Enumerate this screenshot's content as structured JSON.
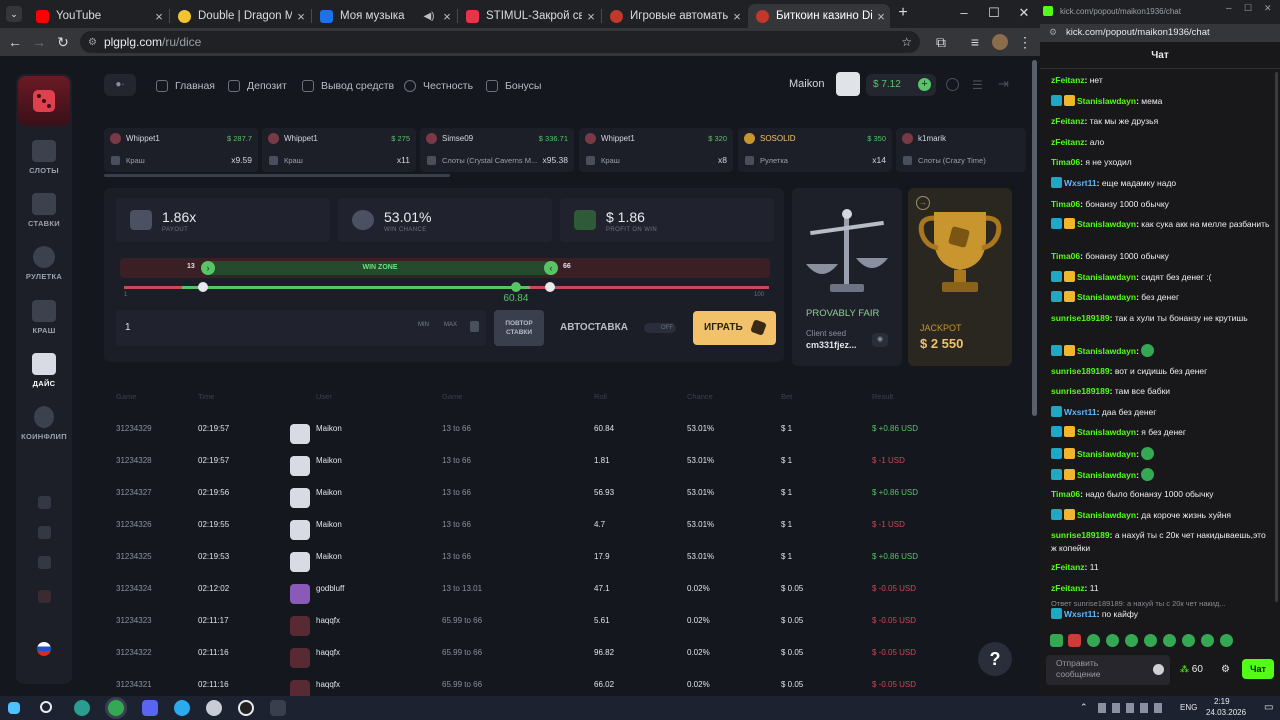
{
  "browser": {
    "tabs": [
      {
        "title": "YouTube",
        "color": "#ff0000"
      },
      {
        "title": "Double | Dragon Money",
        "color": "#f4c430"
      },
      {
        "title": "Моя музыка",
        "color": "#1a73e8"
      },
      {
        "title": "STIMUL-Закрой свой рот",
        "color": "#e8334a"
      },
      {
        "title": "Игровые автоматы на ре",
        "color": "#c0392b"
      },
      {
        "title": "Биткоин казино Dice | Дон",
        "color": "#c0392b"
      }
    ],
    "new_tab": "+",
    "url_domain": "plgplg.com",
    "url_path": "/ru/dice"
  },
  "site": {
    "nav": [
      "Главная",
      "Депозит",
      "Вывод средств",
      "Честность",
      "Бонусы"
    ],
    "username": "Maikon",
    "balance": "$ 7.12",
    "sidebar": [
      {
        "label": "СЛОТЫ",
        "icon": "slots-icon"
      },
      {
        "label": "СТАВКИ",
        "icon": "ticket-icon"
      },
      {
        "label": "РУЛЕТКА",
        "icon": "roulette-icon"
      },
      {
        "label": "КРАШ",
        "icon": "chart-icon"
      },
      {
        "label": "ДАЙС",
        "icon": "dice-icon"
      },
      {
        "label": "КОИНФЛИП",
        "icon": "coinflip-icon"
      }
    ],
    "lang": "RU"
  },
  "feed": [
    {
      "user": "Whippet1",
      "amount": "$ 287.7",
      "game": "Краш",
      "mult": "x9.59"
    },
    {
      "user": "Whippet1",
      "amount": "$ 275",
      "game": "Краш",
      "mult": "x11"
    },
    {
      "user": "Simse09",
      "amount": "$ 336.71",
      "game": "Слоты (Crystal Caverns M...",
      "mult": "x95.38"
    },
    {
      "user": "Whippet1",
      "amount": "$ 320",
      "game": "Краш",
      "mult": "x8"
    },
    {
      "user": "SOSOLID",
      "amount": "$ 350",
      "game": "Рулетка",
      "mult": "x14"
    },
    {
      "user": "k1marik",
      "amount": "",
      "game": "Слоты (Crazy Time)",
      "mult": ""
    }
  ],
  "game": {
    "payout_value": "1.86x",
    "payout_label": "PAYOUT",
    "chance_value": "53.01%",
    "chance_label": "WIN CHANCE",
    "profit_value": "$ 1.86",
    "profit_label": "PROFIT ON WIN",
    "range_low": "13",
    "range_high": "66",
    "win_zone": "WIN ZONE",
    "scale_min": "1",
    "scale_max": "100",
    "roll_result": "60.84",
    "roll_fraction": 0.6084,
    "bet_value": "1",
    "min": "MIN",
    "max": "MAX",
    "repeat_line1": "ПОВТОР",
    "repeat_line2": "СТАВКИ",
    "autobet": "АВТОСТАВКА",
    "toggle": "OFF",
    "play": "ИГРАТЬ"
  },
  "fair": {
    "title": "PROVABLY FAIR",
    "seed_label": "Client seed",
    "seed": "cm331fjez..."
  },
  "jackpot": {
    "label": "JACKPOT",
    "amount": "$ 2 550"
  },
  "table": {
    "headers": [
      "Game",
      "Time",
      "User",
      "Game",
      "Roll",
      "Chance",
      "Bet",
      "Result"
    ],
    "rows": [
      {
        "id": "31234329",
        "time": "02:19:57",
        "user": "Maikon",
        "game": "13 to 66",
        "roll": "60.84",
        "chance": "53.01%",
        "bet": "$ 1",
        "result": "$ +0.86 USD",
        "win": true
      },
      {
        "id": "31234328",
        "time": "02:19:57",
        "user": "Maikon",
        "game": "13 to 66",
        "roll": "1.81",
        "chance": "53.01%",
        "bet": "$ 1",
        "result": "$ -1 USD",
        "win": false
      },
      {
        "id": "31234327",
        "time": "02:19:56",
        "user": "Maikon",
        "game": "13 to 66",
        "roll": "56.93",
        "chance": "53.01%",
        "bet": "$ 1",
        "result": "$ +0.86 USD",
        "win": true
      },
      {
        "id": "31234326",
        "time": "02:19:55",
        "user": "Maikon",
        "game": "13 to 66",
        "roll": "4.7",
        "chance": "53.01%",
        "bet": "$ 1",
        "result": "$ -1 USD",
        "win": false
      },
      {
        "id": "31234325",
        "time": "02:19:53",
        "user": "Maikon",
        "game": "13 to 66",
        "roll": "17.9",
        "chance": "53.01%",
        "bet": "$ 1",
        "result": "$ +0.86 USD",
        "win": true
      },
      {
        "id": "31234324",
        "time": "02:12:02",
        "user": "godbluff",
        "game": "13 to 13.01",
        "roll": "47.1",
        "chance": "0.02%",
        "bet": "$ 0.05",
        "result": "$ -0.05 USD",
        "win": false
      },
      {
        "id": "31234323",
        "time": "02:11:17",
        "user": "haqqfx",
        "game": "65.99 to 66",
        "roll": "5.61",
        "chance": "0.02%",
        "bet": "$ 0.05",
        "result": "$ -0.05 USD",
        "win": false
      },
      {
        "id": "31234322",
        "time": "02:11:16",
        "user": "haqqfx",
        "game": "65.99 to 66",
        "roll": "96.82",
        "chance": "0.02%",
        "bet": "$ 0.05",
        "result": "$ -0.05 USD",
        "win": false
      },
      {
        "id": "31234321",
        "time": "02:11:16",
        "user": "haqqfx",
        "game": "65.99 to 66",
        "roll": "66.02",
        "chance": "0.02%",
        "bet": "$ 0.05",
        "result": "$ -0.05 USD",
        "win": false
      }
    ]
  },
  "help": "?",
  "chat": {
    "url": "kick.com/popout/maikon1936/chat",
    "title": "Чат",
    "messages": [
      {
        "user": "zFeitanz",
        "color": "#53fc18",
        "text": "нет",
        "badges": 0
      },
      {
        "user": "Stanislawdayn",
        "color": "#53fc18",
        "text": "мема",
        "badges": 2
      },
      {
        "user": "zFeitanz",
        "color": "#53fc18",
        "text": "так мы же друзья",
        "badges": 0
      },
      {
        "user": "zFeitanz",
        "color": "#53fc18",
        "text": "ало",
        "badges": 0
      },
      {
        "user": "Tima06",
        "color": "#53fc18",
        "text": "я не уходил",
        "badges": 0
      },
      {
        "user": "Wxsrt11",
        "color": "#5cb8ff",
        "text": "еще мадамку надо",
        "badges": 1
      },
      {
        "user": "Tima06",
        "color": "#53fc18",
        "text": "бонанзу 1000 обычку",
        "badges": 0
      },
      {
        "user": "Stanislawdayn",
        "color": "#53fc18",
        "text": "как сука акк на мелле разбанить",
        "badges": 2
      },
      {
        "user": "Tima06",
        "color": "#53fc18",
        "text": "бонанзу 1000 обычку",
        "badges": 0
      },
      {
        "user": "Stanislawdayn",
        "color": "#53fc18",
        "text": "сидят без денег :(",
        "badges": 2
      },
      {
        "user": "Stanislawdayn",
        "color": "#53fc18",
        "text": "без денег",
        "badges": 2
      },
      {
        "user": "sunrise189189",
        "color": "#53fc18",
        "text": "так а хули ты бонанзу не крутишь",
        "badges": 0
      },
      {
        "user": "Stanislawdayn",
        "color": "#53fc18",
        "text": "",
        "badges": 2,
        "emote": true
      },
      {
        "user": "sunrise189189",
        "color": "#53fc18",
        "text": "вот и сидишь без денег",
        "badges": 0
      },
      {
        "user": "sunrise189189",
        "color": "#53fc18",
        "text": "там все бабки",
        "badges": 0
      },
      {
        "user": "Wxsrt11",
        "color": "#5cb8ff",
        "text": "даа без денег",
        "badges": 1
      },
      {
        "user": "Stanislawdayn",
        "color": "#53fc18",
        "text": "я без денег",
        "badges": 2
      },
      {
        "user": "Stanislawdayn",
        "color": "#53fc18",
        "text": "",
        "badges": 2,
        "emote": true
      },
      {
        "user": "Stanislawdayn",
        "color": "#53fc18",
        "text": "",
        "badges": 2,
        "emote": true
      },
      {
        "user": "Tima06",
        "color": "#53fc18",
        "text": "надо было бонанзу 1000 обычку",
        "badges": 0
      },
      {
        "user": "Stanislawdayn",
        "color": "#53fc18",
        "text": "да короче жизнь хуйня",
        "badges": 2
      },
      {
        "user": "sunrise189189",
        "color": "#53fc18",
        "text": "а нахуй ты с 20к чет накидываешь,это ж копейки",
        "badges": 0
      },
      {
        "user": "zFeitanz",
        "color": "#53fc18",
        "text": "11",
        "badges": 0
      },
      {
        "user": "zFeitanz",
        "color": "#53fc18",
        "text": "11",
        "badges": 0
      }
    ],
    "reply_preview": "Ответ sunrise189189: а нахуй ты с 20к чет накид...",
    "reply_user": "Wxsrt11",
    "reply_text": "по кайфу",
    "input_placeholder": "Отправить сообщение",
    "points": "60",
    "send": "Чат"
  },
  "taskbar": {
    "lang": "ENG",
    "time": "2:19",
    "date": "24.03.2026"
  }
}
